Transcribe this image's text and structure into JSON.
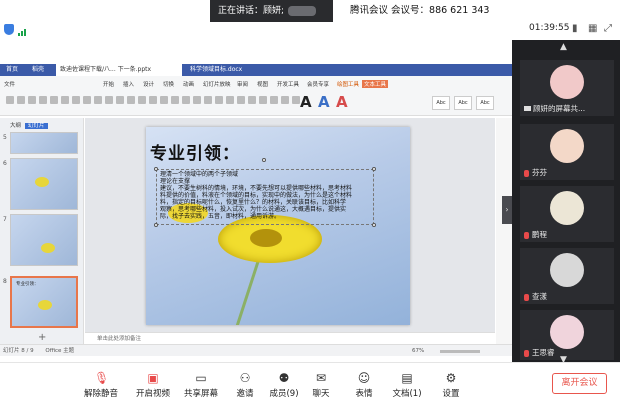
{
  "meeting": {
    "speaking_label": "正在讲话：顾妍;",
    "title": "腾讯会议 会议号：886 621 343",
    "elapsed": "01:39:55"
  },
  "wps": {
    "tabs": [
      "首页",
      "稻壳",
      "致迪佐课程下载/八... 下一条.pptx",
      "科学领域目标.docx"
    ],
    "menus": [
      "文件",
      "开始",
      "插入",
      "设计",
      "切换",
      "动画",
      "幻灯片放映",
      "审阅",
      "视图",
      "开发工具",
      "会员专享",
      "绘图工具",
      "文本工具"
    ],
    "slide_panel_tabs": [
      "大纲",
      "幻灯片"
    ],
    "thumb_numbers": [
      "5",
      "6",
      "7",
      "8"
    ],
    "thumb_title": "专业引领：",
    "slide_title": "专业引领：",
    "slide_lines": [
      "理清一个领域中的两个子领域",
      "理论在支撑",
      "建议，不要生树科的情境，环境，不要先想可以提供哪些材料，思考材料",
      "料提供的价值，料液在个领域的目标，实现中的做法，为什么是这个材料",
      "料，指定的目标呢什么，恢复里什么？的材料，关联该目标，比如科学",
      "观察，思考哪些材料，投入试次，为什么说通这，大概遇目标，提供实",
      "际，找子去实践，五音，即材料，通用诉游。"
    ],
    "notes_placeholder": "单击此处添加备注",
    "status_left": "幻灯片 8 / 9",
    "status_theme": "Office 主题",
    "zoom": "67%"
  },
  "participants": [
    {
      "name": "顾妍的屏幕共...",
      "muted": false,
      "avatar_color": "#f1c9c9"
    },
    {
      "name": "芬芬",
      "muted": true,
      "avatar_color": "#f3d8c8"
    },
    {
      "name": "鹏程",
      "muted": true,
      "avatar_color": "#ece6d6"
    },
    {
      "name": "查漾",
      "muted": true,
      "avatar_color": "#d8d8d8"
    },
    {
      "name": "王思睿",
      "muted": true,
      "avatar_color": "#f0d4dc"
    }
  ],
  "toolbar": {
    "items": [
      "解除静音",
      "开启视频",
      "共享屏幕",
      "邀请",
      "成员(9)",
      "聊天",
      "表情",
      "文档(1)",
      "设置"
    ],
    "leave": "离开会议"
  },
  "colors": {
    "accent": "#3b5aa8",
    "leave": "#e8564d",
    "participant_bg": "#2b2c30"
  }
}
